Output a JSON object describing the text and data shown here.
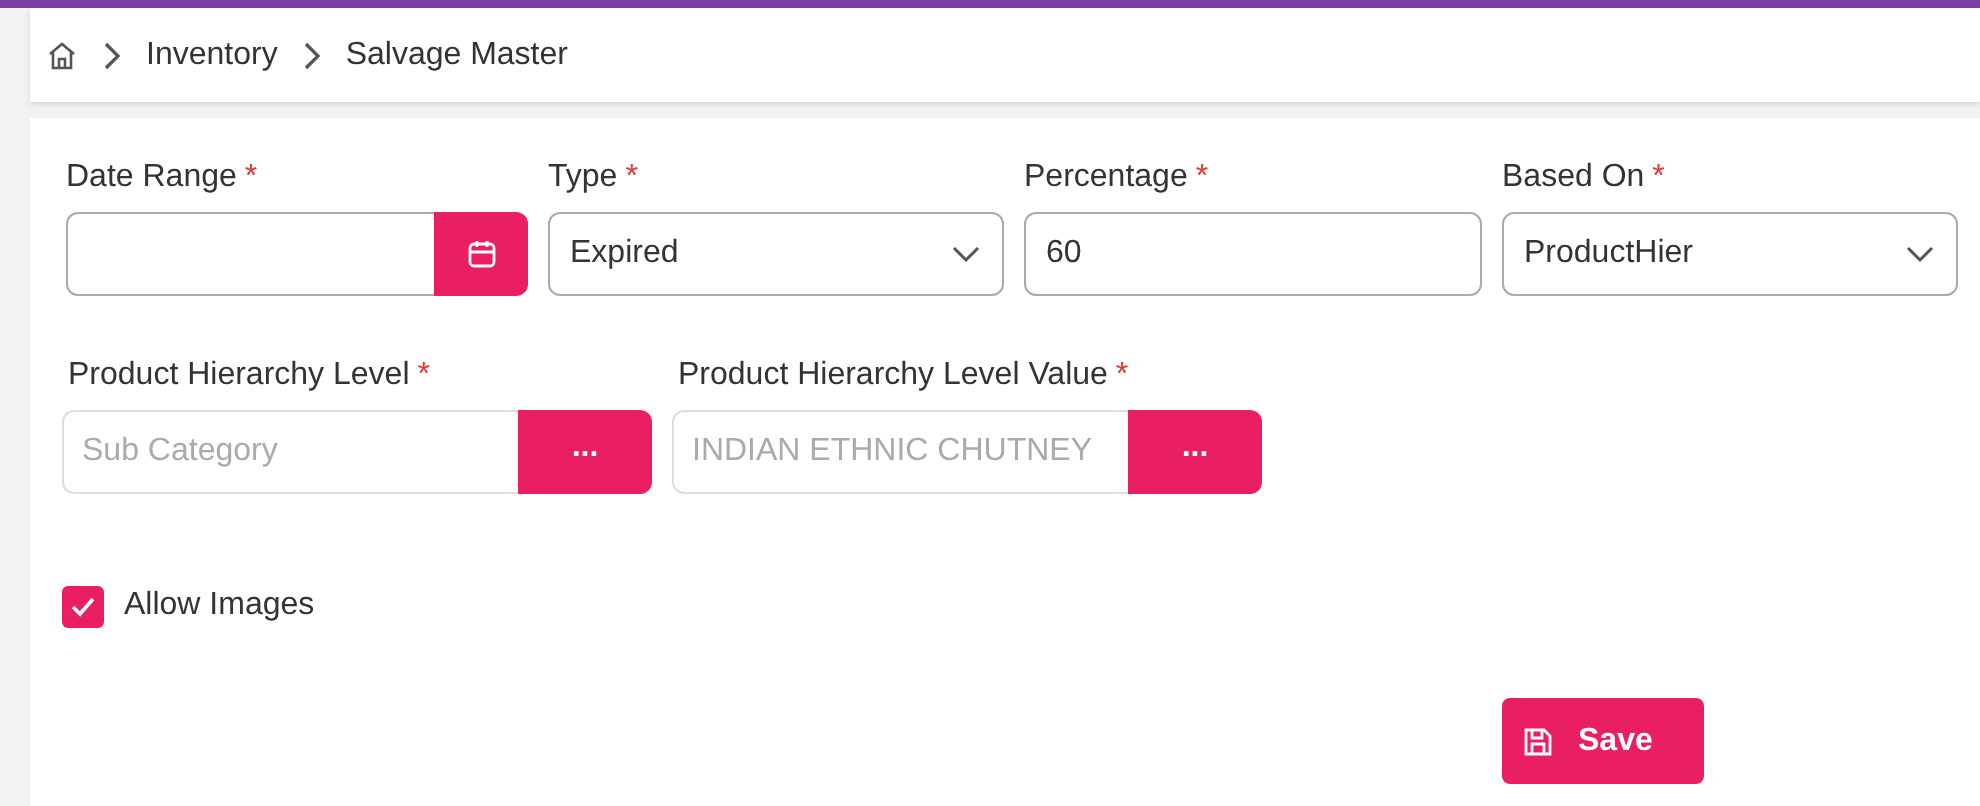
{
  "breadcrumb": [
    {
      "label": "Inventory"
    },
    {
      "label": "Salvage Master"
    }
  ],
  "row_1": [
    {
      "kind": "date",
      "label": "Date Range",
      "required_mark": "*"
    },
    {
      "kind": "select",
      "label": "Type",
      "required_mark": "*",
      "value": "Expired"
    },
    {
      "kind": "text",
      "label": "Percentage",
      "required_mark": "*",
      "value": "60"
    },
    {
      "kind": "select",
      "label": "Based On",
      "required_mark": "*",
      "value": "ProductHier"
    }
  ],
  "row_2": [
    {
      "label": "Product Hierarchy Level",
      "required_mark": "*",
      "value": "Sub Category",
      "disabled": true,
      "button": "..."
    },
    {
      "label": "Product Hierarchy Level Value",
      "required_mark": "*",
      "value": "INDIAN ETHNIC CHUTNEY",
      "disabled": true,
      "button": "..."
    }
  ],
  "allow_images": {
    "label": "Allow Images",
    "checked": true
  },
  "save_button": "Save"
}
